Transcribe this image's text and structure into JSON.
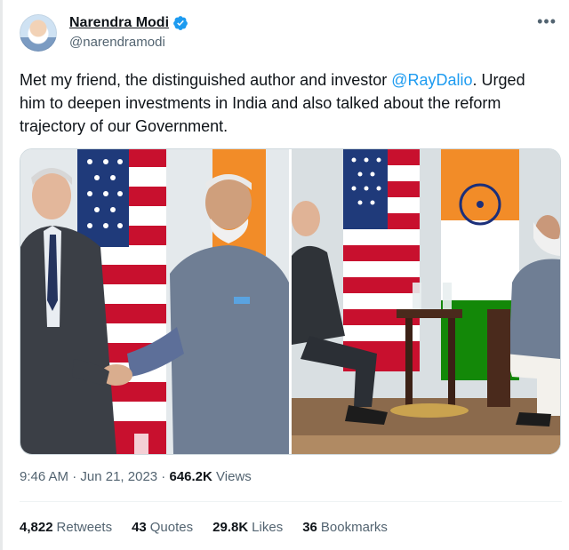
{
  "author": {
    "display_name": "Narendra Modi",
    "handle": "@narendramodi",
    "verified_color": "#1d9bf0"
  },
  "tweet": {
    "text_before": "Met my friend, the distinguished author and investor ",
    "mention": "@RayDalio",
    "text_after": ". Urged him to deepen investments in India and also talked about the reform trajectory of our Government."
  },
  "meta": {
    "time": "9:46 AM",
    "separator": " · ",
    "date": "Jun 21, 2023",
    "views_count": "646.2K",
    "views_label": "Views"
  },
  "stats": [
    {
      "count": "4,822",
      "label": "Retweets"
    },
    {
      "count": "43",
      "label": "Quotes"
    },
    {
      "count": "29.8K",
      "label": "Likes"
    },
    {
      "count": "36",
      "label": "Bookmarks"
    }
  ],
  "icons": {
    "more": "more-icon",
    "verified": "verified-badge-icon"
  },
  "colors": {
    "accent": "#1d9bf0",
    "secondary_text": "#536471",
    "primary_text": "#0f1419"
  }
}
